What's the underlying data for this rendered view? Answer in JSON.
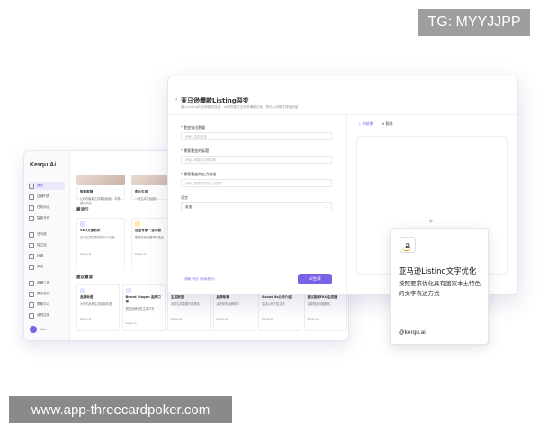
{
  "watermarks": {
    "top": "TG: MYYJJPP",
    "bottom": "www.app-threecardpoker.com"
  },
  "back_window": {
    "logo": "Kerqu.Ai",
    "sidebar": [
      {
        "label": "首页",
        "active": true
      },
      {
        "label": "店铺列表"
      },
      {
        "label": "在线对话"
      },
      {
        "label": "智能写作"
      },
      {
        "label": "亚马逊"
      },
      {
        "label": "独立站"
      },
      {
        "label": "社媒"
      },
      {
        "label": "其他"
      },
      {
        "label": "收藏工具"
      },
      {
        "label": "联系我们"
      },
      {
        "label": "帮助中心"
      },
      {
        "label": "我的应用"
      }
    ],
    "user": "User",
    "top_cards": [
      {
        "t": "智能客服",
        "d": "让你的客服工作更加轻松，不再错过商机"
      },
      {
        "t": "图片生成",
        "d": "一键生成产品图片"
      }
    ],
    "section_popular": "最流行",
    "popular_cards": [
      {
        "t": "SEO文案助手",
        "d": "自动生成高质量的SEO文案"
      },
      {
        "t": "选品专家 · 亚马逊",
        "d": "根据热卖数据帮你选品"
      }
    ],
    "section_recommend": "建议重读",
    "recommend_cards": [
      {
        "t": "品牌标语",
        "d": "为你的品牌生成独特标语"
      },
      {
        "t": "Brand Slogan 品牌口号",
        "d": "根据品牌调性生成口号"
      },
      {
        "t": "生成报告",
        "d": "自动生成数据分析报告"
      },
      {
        "t": "品牌故事",
        "d": "讲述你的品牌故事"
      },
      {
        "t": "About Us公司介绍",
        "d": "生成公司介绍文案"
      },
      {
        "t": "建议高频FAQ生成器",
        "d": "生成常见问题解答"
      }
    ],
    "card_meta": "Kerqu.ai"
  },
  "front_window": {
    "title": "亚马逊爆款Listing裂变",
    "subtitle": "输入Listing内容和相关描述，AI帮你裂变出多条爆款文案，帮你占领更多搜索流量",
    "fields": [
      {
        "label": "裂变输出数量",
        "placeholder": "请输入裂变数量"
      },
      {
        "label": "需要裂变的标题",
        "placeholder": "请输入需要裂变的标题"
      },
      {
        "label": "需要裂变的五点描述",
        "placeholder": "请输入需要裂变的五点描述"
      }
    ],
    "language_label": "语言",
    "language_value": "英语",
    "cost": "消耗 积分 (剩余积分)",
    "generate_button": "AI生成",
    "tabs": [
      "AI结果",
      "翻译"
    ],
    "empty_text": "AI结果"
  },
  "overlay_card": {
    "icon": "amazon-icon",
    "icon_letter": "a",
    "title": "亚马逊Listing文字优化",
    "description": "按照要求优化具有国家本土特色的文字表达方式",
    "handle": "@kerqu.ai",
    "accent": "#f39a1e"
  },
  "colors": {
    "brand": "#7b61e8"
  }
}
